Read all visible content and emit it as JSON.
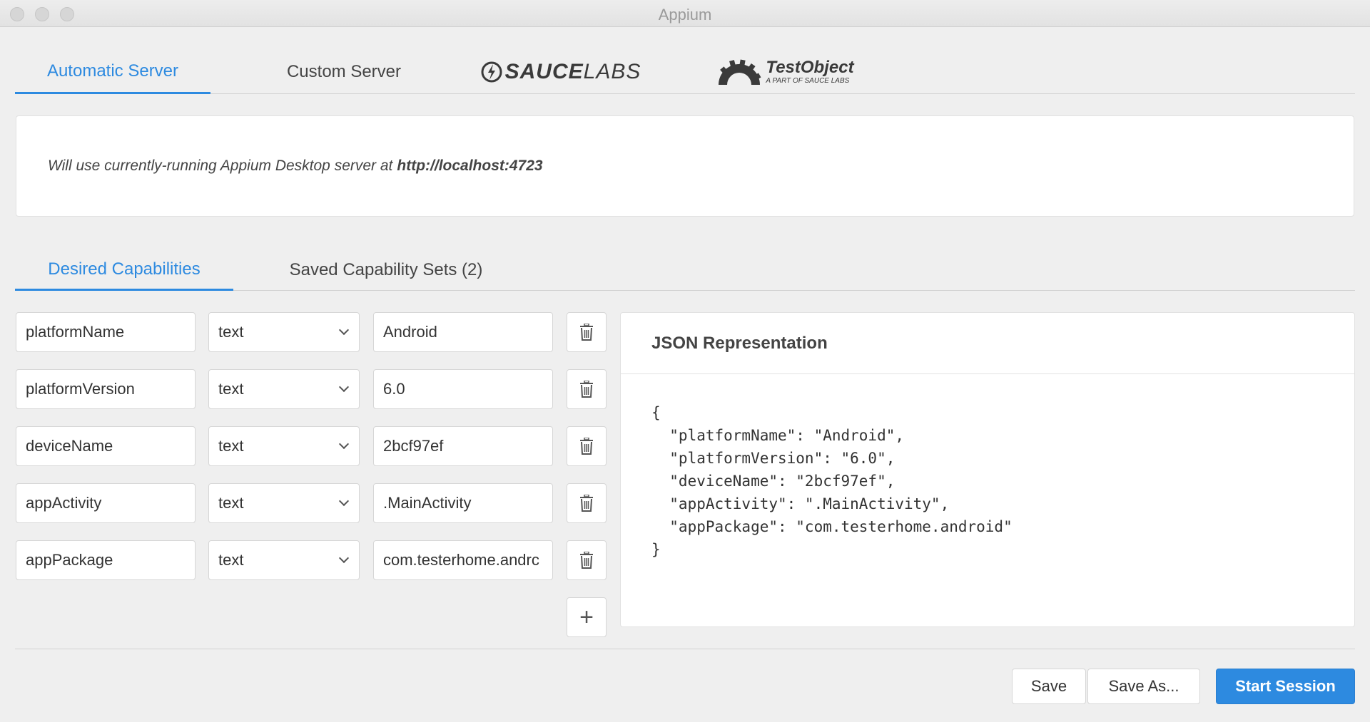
{
  "window": {
    "title": "Appium"
  },
  "server_tabs": {
    "automatic": "Automatic Server",
    "custom": "Custom Server",
    "saucelabs_logo": {
      "bold": "SAUCE",
      "light": "LABS"
    },
    "testobject_logo": {
      "main": "TestObject",
      "sub": "A PART OF SAUCE LABS"
    }
  },
  "info": {
    "text": "Will use currently-running Appium Desktop server at",
    "url": "http://localhost:4723"
  },
  "cap_tabs": {
    "desired": "Desired Capabilities",
    "saved": "Saved Capability Sets (2)"
  },
  "capabilities": [
    {
      "name": "platformName",
      "type": "text",
      "value": "Android"
    },
    {
      "name": "platformVersion",
      "type": "text",
      "value": "6.0"
    },
    {
      "name": "deviceName",
      "type": "text",
      "value": "2bcf97ef"
    },
    {
      "name": "appActivity",
      "type": "text",
      "value": ".MainActivity"
    },
    {
      "name": "appPackage",
      "type": "text",
      "value": "com.testerhome.andrc"
    }
  ],
  "add_button": "+",
  "json_panel": {
    "title": "JSON Representation",
    "body": "{\n  \"platformName\": \"Android\",\n  \"platformVersion\": \"6.0\",\n  \"deviceName\": \"2bcf97ef\",\n  \"appActivity\": \".MainActivity\",\n  \"appPackage\": \"com.testerhome.android\"\n}"
  },
  "footer": {
    "save": "Save",
    "save_as": "Save As...",
    "start_session": "Start Session"
  },
  "colors": {
    "accent": "#2d8ae0"
  }
}
